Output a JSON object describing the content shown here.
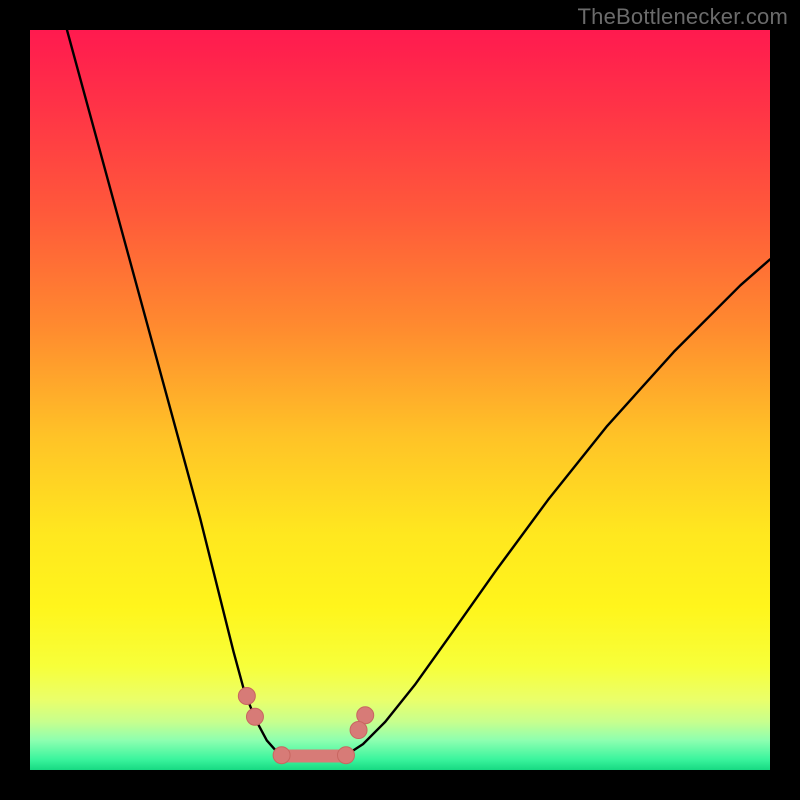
{
  "watermark": "TheBottlenecker.com",
  "colors": {
    "bg_black": "#000000",
    "curve": "#000000",
    "marker_fill": "#d77b77",
    "marker_stroke": "#c86660",
    "gradient_stops": [
      {
        "offset": 0.0,
        "color": "#ff1a4f"
      },
      {
        "offset": 0.1,
        "color": "#ff3247"
      },
      {
        "offset": 0.25,
        "color": "#ff5a3a"
      },
      {
        "offset": 0.4,
        "color": "#ff8a2f"
      },
      {
        "offset": 0.55,
        "color": "#ffc327"
      },
      {
        "offset": 0.68,
        "color": "#ffe71f"
      },
      {
        "offset": 0.78,
        "color": "#fff51c"
      },
      {
        "offset": 0.86,
        "color": "#f7ff3a"
      },
      {
        "offset": 0.905,
        "color": "#eaff6a"
      },
      {
        "offset": 0.935,
        "color": "#c7ff8e"
      },
      {
        "offset": 0.96,
        "color": "#8dffb0"
      },
      {
        "offset": 0.985,
        "color": "#3cf59e"
      },
      {
        "offset": 1.0,
        "color": "#17d982"
      }
    ]
  },
  "chart_data": {
    "type": "line",
    "title": "",
    "xlabel": "",
    "ylabel": "",
    "xlim": [
      0,
      100
    ],
    "ylim": [
      0,
      100
    ],
    "note": "x is horizontal position (% of plot width), y is bottleneck magnitude (% — 0 at bottom, 100 at top). Values estimated from pixels; no axis ticks are shown in the image.",
    "series": [
      {
        "name": "left-branch",
        "x": [
          5,
          8,
          11,
          14,
          17,
          20,
          23,
          25.5,
          27.5,
          29,
          30.5,
          32,
          33.5
        ],
        "y": [
          100,
          89,
          78,
          67,
          56,
          45,
          34,
          24,
          16,
          10.5,
          6.8,
          4.0,
          2.3
        ]
      },
      {
        "name": "valley-floor",
        "x": [
          33.5,
          35,
          37,
          39,
          41,
          43
        ],
        "y": [
          2.3,
          1.7,
          1.4,
          1.4,
          1.6,
          2.2
        ]
      },
      {
        "name": "right-branch",
        "x": [
          43,
          45,
          48,
          52,
          57,
          63,
          70,
          78,
          87,
          96,
          100
        ],
        "y": [
          2.2,
          3.5,
          6.5,
          11.5,
          18.5,
          27,
          36.5,
          46.5,
          56.5,
          65.5,
          69
        ]
      }
    ],
    "markers": [
      {
        "name": "left-marker-upper",
        "x": 29.3,
        "y": 10.0
      },
      {
        "name": "left-marker-lower",
        "x": 30.4,
        "y": 7.2
      },
      {
        "name": "right-marker-upper",
        "x": 45.3,
        "y": 7.4
      },
      {
        "name": "right-marker-lower",
        "x": 44.4,
        "y": 5.4
      },
      {
        "name": "floor-cap-left",
        "x": 34.0,
        "y": 2.0
      },
      {
        "name": "floor-cap-right",
        "x": 42.7,
        "y": 2.0
      }
    ],
    "floor_segment": {
      "x0": 34.0,
      "x1": 42.7,
      "y": 1.9
    }
  }
}
